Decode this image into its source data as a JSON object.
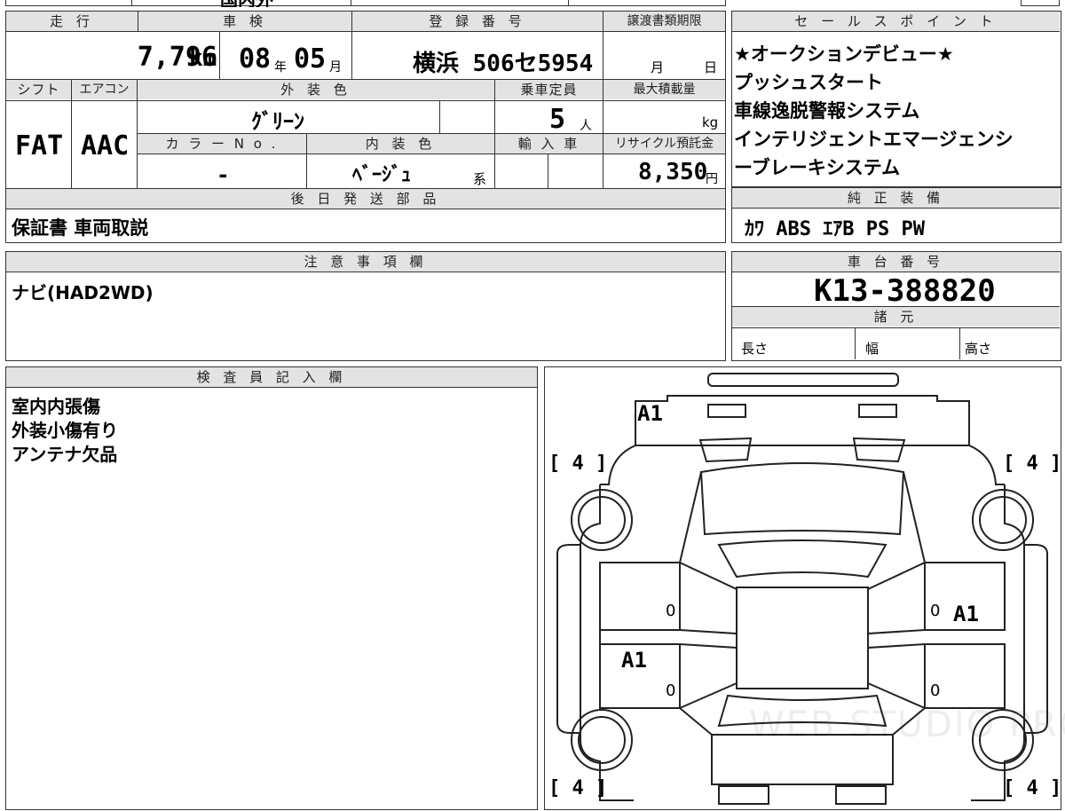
{
  "top_stub": {
    "text": "国内外"
  },
  "main_sheet": {
    "headers": {
      "mileage": "走 行",
      "inspection": "車 検",
      "registration": "登 録 番 号",
      "transfer_deadline": "譲渡書類期限",
      "shift": "シフト",
      "aircon": "エアコン",
      "exterior_color": "外 装 色",
      "capacity": "乗車定員",
      "max_load": "最大積載量",
      "color_no": "カ ラ ー N o .",
      "interior_color": "内 装 色",
      "import": "輸 入 車",
      "recycle": "リサイクル預託金",
      "later_parts": "後 日 発 送 部 品"
    },
    "mileage_value": "7,796",
    "mileage_unit": "km",
    "inspection_year": "08",
    "inspection_year_unit": "年",
    "inspection_month": "05",
    "inspection_month_unit": "月",
    "registration_value": "横浜 506セ5954",
    "transfer_month_unit": "月",
    "transfer_day_unit": "日",
    "shift_value": "FAT",
    "aircon_value": "AAC",
    "exterior_color_value": "ｸﾞﾘｰﾝ",
    "capacity_value": "5",
    "capacity_unit": "人",
    "max_load_unit": "kg",
    "color_no_value": "-",
    "interior_color_value": "ﾍﾞｰｼﾞｭ",
    "interior_suffix": "系",
    "recycle_value": "8,350",
    "recycle_unit": "円",
    "later_parts_value": "保証書 車両取説"
  },
  "sales_points": {
    "header": "セ ー ル ス ポ イ ン ト",
    "lines": [
      "★オークションデビュー★",
      "プッシュスタート",
      "車線逸脱警報システム",
      "インテリジェントエマージェンシ",
      "ーブレーキシステム"
    ]
  },
  "genuine_equipment": {
    "header": "純 正 装 備",
    "value": "ｶﾜ ABS ｴｱB PS PW"
  },
  "notes": {
    "header": "注 意 事 項 欄",
    "value": "ナビ(HAD2WD)"
  },
  "chassis": {
    "header": "車 台 番 号",
    "value": "K13-388820",
    "specs_header": "諸 元",
    "length_label": "長さ",
    "width_label": "幅",
    "height_label": "高さ"
  },
  "inspector": {
    "header": "検 査 員 記 入 欄",
    "lines": [
      "室内内張傷",
      "外装小傷有り",
      "アンテナ欠品"
    ]
  },
  "diagram": {
    "tire_marks": [
      "[ 4 ]",
      "[ 4 ]",
      "[ 4 ]",
      "[ 4 ]"
    ],
    "damage_codes": [
      "A1",
      "A1",
      "A1"
    ],
    "zero_marks": [
      "0",
      "0",
      "0",
      "0"
    ],
    "watermark": "WEB STUDIO PRO"
  }
}
